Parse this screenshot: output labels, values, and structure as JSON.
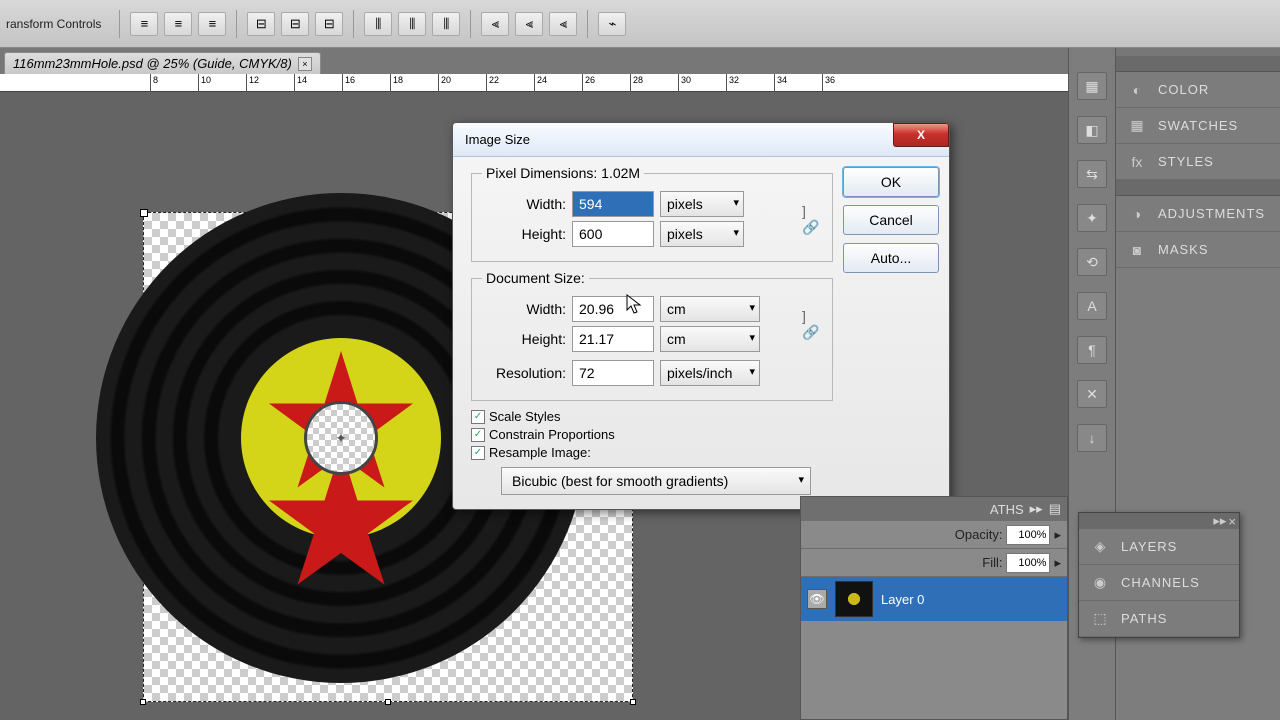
{
  "optbar": {
    "label": "ransform Controls"
  },
  "tab": {
    "label": "116mm23mmHole.psd @ 25% (Guide, CMYK/8)"
  },
  "ruler_ticks": [
    "8",
    "10",
    "12",
    "14",
    "16",
    "18",
    "20",
    "22",
    "24",
    "26",
    "28",
    "30",
    "32",
    "34",
    "36"
  ],
  "dialog": {
    "title": "Image Size",
    "pixel_legend": "Pixel Dimensions: 1.02M",
    "width_lbl": "Width:",
    "height_lbl": "Height:",
    "px_width": "594",
    "px_height": "600",
    "px_unit": "pixels",
    "doc_legend": "Document Size:",
    "doc_width": "20.96",
    "doc_height": "21.17",
    "doc_unit": "cm",
    "res_lbl": "Resolution:",
    "res_val": "72",
    "res_unit": "pixels/inch",
    "scale_styles": "Scale Styles",
    "constrain": "Constrain Proportions",
    "resample": "Resample Image:",
    "method": "Bicubic (best for smooth gradients)",
    "ok": "OK",
    "cancel": "Cancel",
    "auto": "Auto..."
  },
  "panels": {
    "color": "COLOR",
    "swatches": "SWATCHES",
    "styles": "STYLES",
    "adjustments": "ADJUSTMENTS",
    "masks": "MASKS",
    "layers": "LAYERS",
    "channels": "CHANNELS",
    "paths": "PATHS"
  },
  "layers": {
    "tab_paths": "ATHS",
    "opacity_lbl": "Opacity:",
    "opacity_val": "100%",
    "fill_lbl": "Fill:",
    "fill_val": "100%",
    "layer0": "Layer 0"
  }
}
